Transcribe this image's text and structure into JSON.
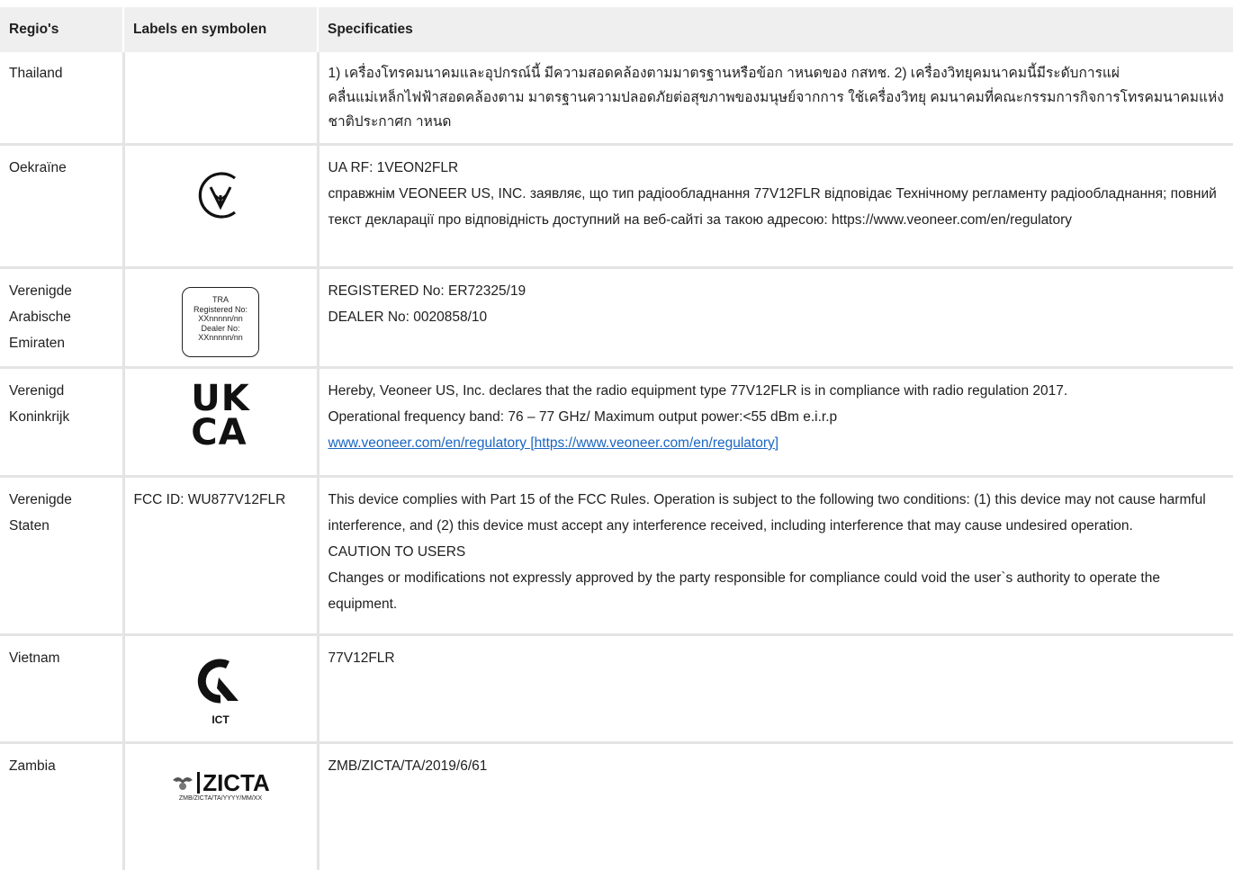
{
  "headers": {
    "region": "Regio's",
    "labels": "Labels en symbolen",
    "specs": "Specificaties"
  },
  "rows": {
    "thailand": {
      "region": "Thailand",
      "spec": "1) เครื่องโทรคมนาคมและอุปกรณ์นี้ มีความสอดคล้องตามมาตรฐานหรือข้อก าหนดของ กสทช. 2) เครื่องวิทยุคมนาคมนี้มีระดับการแผ่คลื่นแม่เหล็กไฟฟ้าสอดคล้องตาม มาตรฐานความปลอดภัยต่อสุขภาพของมนุษย์จากการ ใช้เครื่องวิทยุ คมนาคมที่คณะกรรมการกิจการโทรคมนาคมแห่งชาติประกาศก าหนด"
    },
    "ukraine": {
      "region": "Oekraïne",
      "spec": [
        "UA RF: 1VEON2FLR",
        "справжнім VEONEER US, INC. заявляє, що тип радіообладнання 77V12FLR відповідає Технічному регламенту радіообладнання; повний текст декларації про відповідність доступний на веб-сайті за такою адресою: https://www.veoneer.com/en/regulatory"
      ]
    },
    "uae": {
      "region": "Verenigde Arabische Emiraten",
      "label_lines": [
        "TRA",
        "Registered No:",
        "XXnnnnn/nn",
        "Dealer No:",
        "XXnnnnn/nn"
      ],
      "spec": [
        "REGISTERED No: ER72325/19",
        "DEALER No: 0020858/10"
      ]
    },
    "uk": {
      "region": "Verenigd Koninkrijk",
      "logo_top": "UK",
      "logo_bottom": "CA",
      "spec": [
        "Hereby, Veoneer US, Inc. declares that the radio equipment type 77V12FLR is in compliance with radio regulation 2017.",
        "Operational frequency band: 76 – 77 GHz/ Maximum output power:<55 dBm e.i.r.p"
      ],
      "link": "www.veoneer.com/en/regulatory [https://www.veoneer.com/en/regulatory]"
    },
    "us": {
      "region": "Verenigde Staten",
      "label": "FCC ID: WU877V12FLR",
      "spec": [
        "This device complies with Part 15 of the FCC Rules. Operation is subject to the following two conditions: (1) this device may not cause harmful interference, and (2) this device must accept any interference received, including interference that may cause undesired operation.",
        "CAUTION TO USERS",
        "Changes or modifications not expressly approved by the party responsible for compliance could void the user`s authority to operate the equipment."
      ]
    },
    "vietnam": {
      "region": "Vietnam",
      "logo_text": "ICT",
      "spec": "77V12FLR"
    },
    "zambia": {
      "region": "Zambia",
      "logo_text": "ZICTA",
      "logo_sub": "ZMB/ZICTA/TA/YYYY/MM/XX",
      "spec": "ZMB/ZICTA/TA/2019/6/61"
    }
  }
}
